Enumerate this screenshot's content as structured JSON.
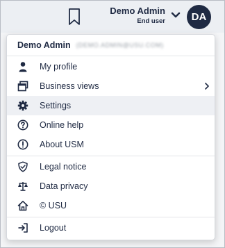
{
  "header": {
    "user_name": "Demo Admin",
    "user_role": "End user",
    "avatar_initials": "DA"
  },
  "menu": {
    "header_name": "Demo Admin",
    "header_email": "(DEMO.ADMIN@USU.COM)",
    "items": [
      {
        "label": "My profile",
        "icon": "person-icon"
      },
      {
        "label": "Business views",
        "icon": "windows-icon"
      },
      {
        "label": "Settings",
        "icon": "gear-icon"
      },
      {
        "label": "Online help",
        "icon": "question-circle-icon"
      },
      {
        "label": "About USM",
        "icon": "exclamation-circle-icon"
      },
      {
        "label": "Legal notice",
        "icon": "shield-icon"
      },
      {
        "label": "Data privacy",
        "icon": "scales-icon"
      },
      {
        "label": "© USU",
        "icon": "home-icon"
      },
      {
        "label": "Logout",
        "icon": "logout-icon"
      }
    ]
  },
  "colors": {
    "primary": "#1f2a43",
    "highlight": "#eef0f4",
    "topbar": "#eceff3"
  }
}
